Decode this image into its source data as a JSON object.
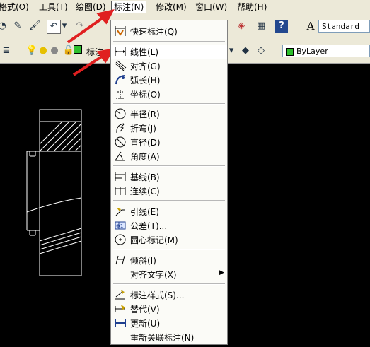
{
  "menubar": {
    "items": [
      {
        "label": "格式(O)"
      },
      {
        "label": "工具(T)"
      },
      {
        "label": "绘图(D)"
      },
      {
        "label": "标注(N)"
      },
      {
        "label": "修改(M)"
      },
      {
        "label": "窗口(W)"
      },
      {
        "label": "帮助(H)"
      }
    ]
  },
  "toolbar": {
    "text_style_combo": "Standard",
    "dim_label": "标注",
    "layer_combo": "ByLayer"
  },
  "dim_menu": {
    "items": [
      {
        "label": "快速标注(Q)",
        "icon": "quick-dimension-icon"
      },
      {
        "label": "线性(L)",
        "icon": "linear-dimension-icon"
      },
      {
        "label": "对齐(G)",
        "icon": "aligned-dimension-icon"
      },
      {
        "label": "弧长(H)",
        "icon": "arc-length-icon"
      },
      {
        "label": "坐标(O)",
        "icon": "ordinate-dimension-icon"
      },
      {
        "label": "半径(R)",
        "icon": "radius-dimension-icon"
      },
      {
        "label": "折弯(J)",
        "icon": "jogged-dimension-icon"
      },
      {
        "label": "直径(D)",
        "icon": "diameter-dimension-icon"
      },
      {
        "label": "角度(A)",
        "icon": "angular-dimension-icon"
      },
      {
        "label": "基线(B)",
        "icon": "baseline-dimension-icon"
      },
      {
        "label": "连续(C)",
        "icon": "continue-dimension-icon"
      },
      {
        "label": "引线(E)",
        "icon": "leader-icon"
      },
      {
        "label": "公差(T)...",
        "icon": "tolerance-icon"
      },
      {
        "label": "圆心标记(M)",
        "icon": "center-mark-icon"
      },
      {
        "label": "倾斜(I)",
        "icon": "oblique-icon"
      },
      {
        "label": "对齐文字(X)",
        "icon": "submenu-arrow-icon"
      },
      {
        "label": "标注样式(S)...",
        "icon": "dimension-style-icon"
      },
      {
        "label": "替代(V)",
        "icon": "override-icon"
      },
      {
        "label": "更新(U)",
        "icon": "update-icon"
      },
      {
        "label": "重新关联标注(N)",
        "icon": "reassociate-icon"
      }
    ]
  },
  "colors": {
    "menu_bg": "#fbfbf7",
    "toolbar_bg": "#ece9d8",
    "canvas_bg": "#000000",
    "annotation_arrow": "#e02020",
    "icon_blue": "#1f3f8f"
  }
}
